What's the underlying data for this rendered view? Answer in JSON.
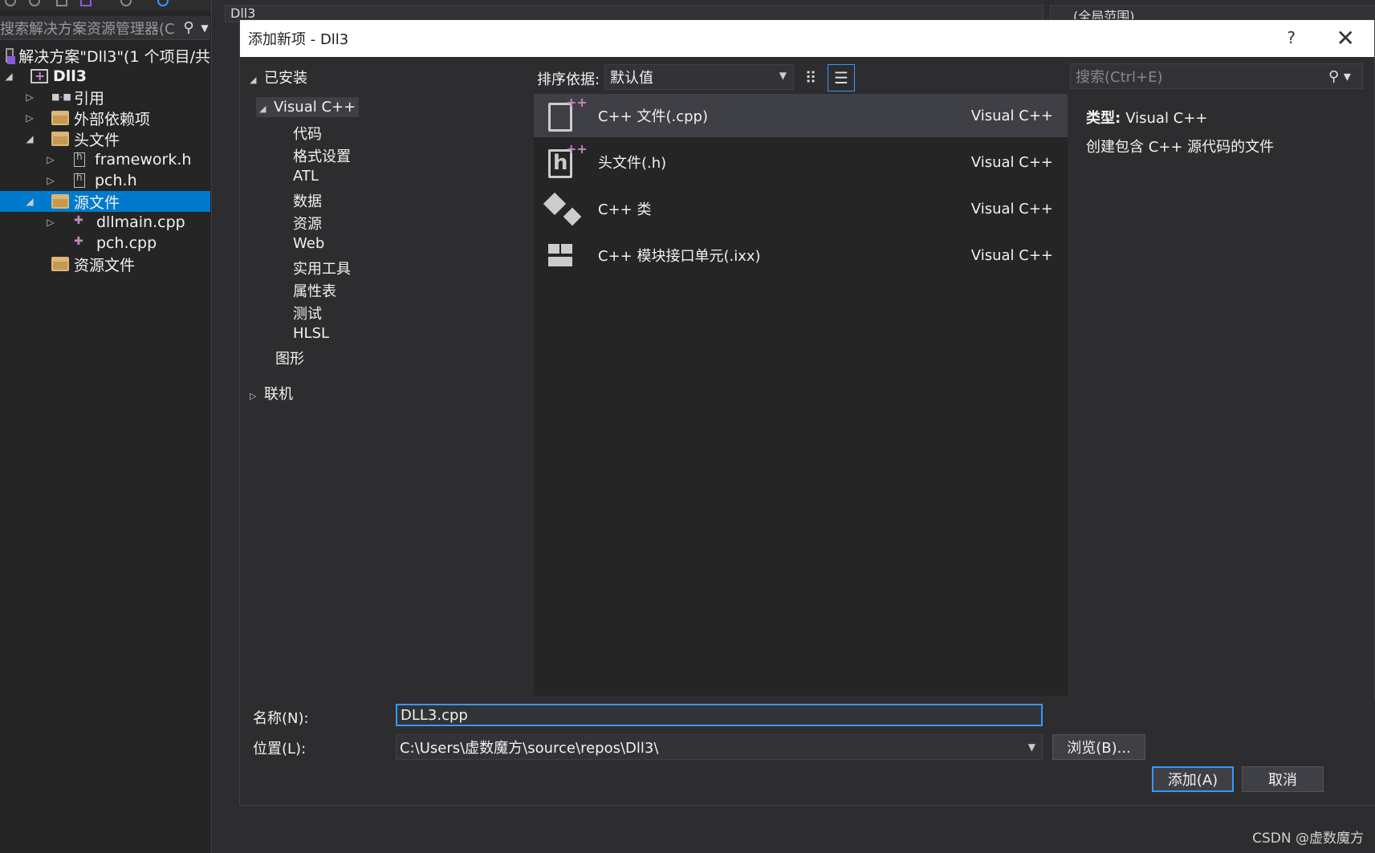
{
  "solution_explorer": {
    "search_placeholder": "搜索解决方案资源管理器(C",
    "tree": [
      {
        "label": "解决方案\"Dll3\"(1 个项目/共",
        "icon": "solution-icon",
        "expand": ""
      },
      {
        "label": "Dll3",
        "icon": "project-icon",
        "expand": "◢"
      },
      {
        "label": "引用",
        "icon": "references-icon",
        "expand": "▷"
      },
      {
        "label": "外部依赖项",
        "icon": "folder-icon",
        "expand": "▷"
      },
      {
        "label": "头文件",
        "icon": "folder-icon",
        "expand": "◢"
      },
      {
        "label": "framework.h",
        "icon": "header-file-icon",
        "expand": "▷"
      },
      {
        "label": "pch.h",
        "icon": "header-file-icon",
        "expand": "▷"
      },
      {
        "label": "源文件",
        "icon": "folder-icon",
        "expand": "◢",
        "selected": true
      },
      {
        "label": "dllmain.cpp",
        "icon": "cpp-file-icon",
        "expand": "▷"
      },
      {
        "label": "pch.cpp",
        "icon": "cpp-file-icon",
        "expand": ""
      },
      {
        "label": "资源文件",
        "icon": "folder-icon",
        "expand": ""
      }
    ]
  },
  "editor": {
    "project_combo": "Dll3",
    "scope_combo": "(全局范围)"
  },
  "dialog": {
    "title": "添加新项 - Dll3",
    "help": "?",
    "close": "✕",
    "categories": {
      "installed": "已安装",
      "visual_cpp": "Visual C++",
      "children": [
        "代码",
        "格式设置",
        "ATL",
        "数据",
        "资源",
        "Web",
        "实用工具",
        "属性表",
        "测试",
        "HLSL"
      ],
      "graphics": "图形",
      "online": "联机"
    },
    "sort_label": "排序依据:",
    "sort_value": "默认值",
    "search_placeholder": "搜索(Ctrl+E)",
    "templates": [
      {
        "name": "C++ 文件(.cpp)",
        "lang": "Visual C++",
        "icon": "cpp-file-template-icon",
        "selected": true
      },
      {
        "name": "头文件(.h)",
        "lang": "Visual C++",
        "icon": "header-file-template-icon"
      },
      {
        "name": "C++ 类",
        "lang": "Visual C++",
        "icon": "class-template-icon"
      },
      {
        "name": "C++ 模块接口单元(.ixx)",
        "lang": "Visual C++",
        "icon": "module-template-icon"
      }
    ],
    "description": {
      "type_label": "类型:",
      "type_value": "Visual C++",
      "text": "创建包含 C++ 源代码的文件"
    },
    "name_label": "名称(N):",
    "name_value": "DLL3.cpp",
    "location_label": "位置(L):",
    "location_value": "C:\\Users\\虚数魔方\\source\\repos\\Dll3\\",
    "browse_button": "浏览(B)...",
    "add_button": "添加(A)",
    "cancel_button": "取消"
  },
  "watermark": "CSDN @虚数魔方",
  "colors": {
    "accent": "#007acc",
    "focus_border": "#3399ff",
    "background": "#2d2d30",
    "panel": "#252526",
    "selected_item": "#3f3f46"
  }
}
